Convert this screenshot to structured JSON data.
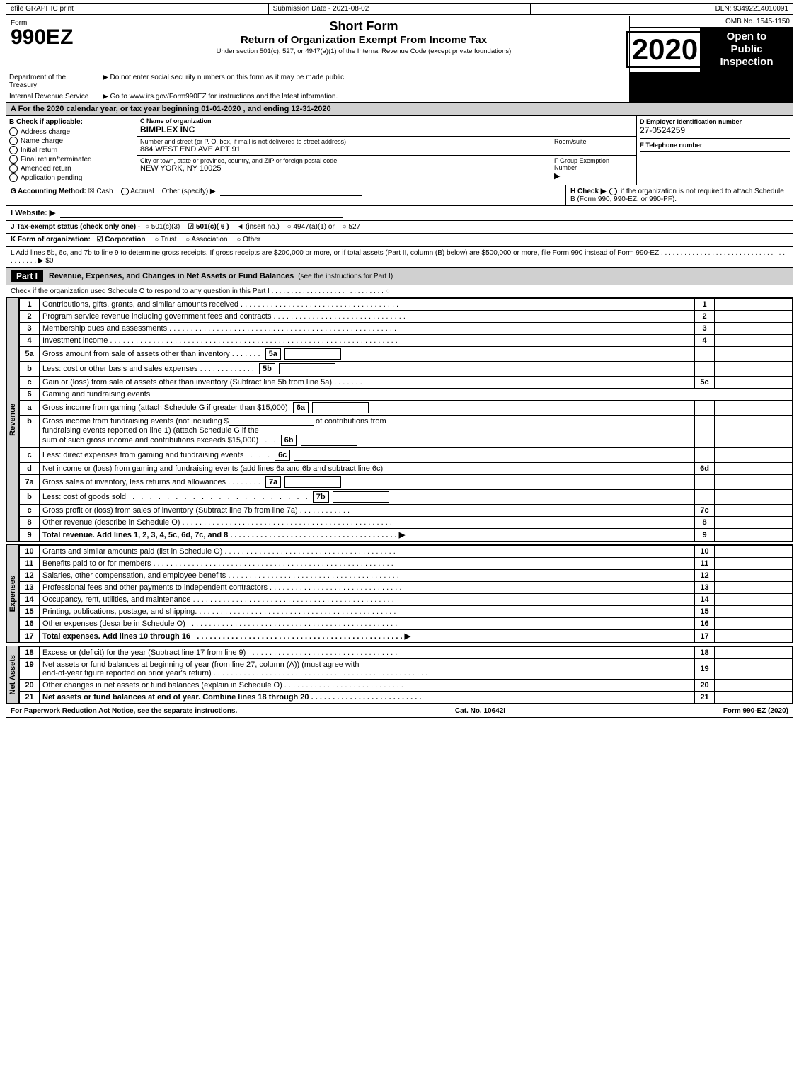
{
  "header": {
    "efile": "efile GRAPHIC print",
    "submission": "Submission Date - 2021-08-02",
    "dln": "DLN: 93492214010091",
    "form_label": "Form",
    "form_number": "990EZ",
    "short_form": "Short Form",
    "return_title": "Return of Organization Exempt From Income Tax",
    "subtitle": "Under section 501(c), 527, or 4947(a)(1) of the Internal Revenue Code (except private foundations)",
    "note1": "▶ Do not enter social security numbers on this form as it may be made public.",
    "note2": "▶ Go to www.irs.gov/Form990EZ for instructions and the latest information.",
    "year": "2020",
    "omb": "OMB No. 1545-1150",
    "open_line1": "Open to",
    "open_line2": "Public",
    "open_line3": "Inspection"
  },
  "dept": {
    "name": "Department of the Treasury",
    "irs": "Internal Revenue Service"
  },
  "year_line": "A  For the 2020 calendar year, or tax year beginning 01-01-2020 , and ending 12-31-2020",
  "section_b": {
    "label": "B  Check if applicable:",
    "items": [
      {
        "label": "Address change",
        "checked": false
      },
      {
        "label": "Name change",
        "checked": false
      },
      {
        "label": "Initial return",
        "checked": false
      },
      {
        "label": "Final return/terminated",
        "checked": false
      },
      {
        "label": "Amended return",
        "checked": false
      },
      {
        "label": "Application pending",
        "checked": false
      }
    ]
  },
  "section_c": {
    "label": "C Name of organization",
    "org_name": "BIMPLEX INC",
    "street_label": "Number and street (or P. O. box, if mail is not delivered to street address)",
    "street": "884 WEST END AVE APT 91",
    "room_label": "Room/suite",
    "room": "",
    "city_label": "City or town, state or province, country, and ZIP or foreign postal code",
    "city": "NEW YORK, NY  10025"
  },
  "section_d": {
    "label": "D Employer identification number",
    "ein": "27-0524259"
  },
  "section_e": {
    "label": "E Telephone number",
    "value": ""
  },
  "section_f": {
    "label": "F Group Exemption Number",
    "arrow": "▶",
    "value": ""
  },
  "section_g": {
    "label": "G Accounting Method:",
    "cash_checked": true,
    "cash_label": "Cash",
    "accrual_label": "Accrual",
    "other_label": "Other (specify) ▶"
  },
  "section_h": {
    "label": "H  Check ▶",
    "circle": "○",
    "text": "if the organization is not required to attach Schedule B (Form 990, 990-EZ, or 990-PF)."
  },
  "website": {
    "label": "I Website: ▶"
  },
  "tax_status": {
    "label": "J Tax-exempt status (check only one) -",
    "options": [
      {
        "label": "501(c)(3)",
        "checked": false
      },
      {
        "label": "501(c)( 6 )",
        "checked": true
      },
      {
        "label": "(insert no.)",
        "checked": false
      },
      {
        "label": "4947(a)(1) or",
        "checked": false
      },
      {
        "label": "527",
        "checked": false
      }
    ]
  },
  "form_org": {
    "label": "K Form of organization:",
    "corporation_checked": true,
    "corporation_label": "Corporation",
    "trust_label": "Trust",
    "association_label": "Association",
    "other_label": "Other"
  },
  "line_l": {
    "text": "L Add lines 5b, 6c, and 7b to line 9 to determine gross receipts. If gross receipts are $200,000 or more, or if total assets (Part II, column (B) below) are $500,000 or more, file Form 990 instead of Form 990-EZ . . . . . . . . . . . . . . . . . . . . . . . . . . . . . . . . . . . . . . . ▶ $0"
  },
  "part1": {
    "header": "Part I",
    "title": "Revenue, Expenses, and Changes in Net Assets or Fund Balances",
    "see_instructions": "(see the instructions for Part I)",
    "schedule_o_check": "Check if the organization used Schedule O to respond to any question in this Part I . . . . . . . . . . . . . . . . . . . . . . . . . . . . . ○",
    "rows": [
      {
        "num": "1",
        "desc": "Contributions, gifts, grants, and similar amounts received . . . . . . . . . . . . . . . . . . . . . . . . . . . . . . . . . . . . .",
        "line": "1",
        "value": ""
      },
      {
        "num": "2",
        "desc": "Program service revenue including government fees and contracts . . . . . . . . . . . . . . . . . . . . . . . . . . . . . . .",
        "line": "2",
        "value": ""
      },
      {
        "num": "3",
        "desc": "Membership dues and assessments . . . . . . . . . . . . . . . . . . . . . . . . . . . . . . . . . . . . . . . . . . . . . . . . . . . . .",
        "line": "3",
        "value": ""
      },
      {
        "num": "4",
        "desc": "Investment income . . . . . . . . . . . . . . . . . . . . . . . . . . . . . . . . . . . . . . . . . . . . . . . . . . . . . . . . . . . . . . . . . . .",
        "line": "4",
        "value": ""
      }
    ],
    "row5a": {
      "num": "5a",
      "desc": "Gross amount from sale of assets other than inventory . . . . . . .",
      "sub": "5a",
      "value": ""
    },
    "row5b": {
      "num": "b",
      "desc": "Less: cost or other basis and sales expenses . . . . . . . . . . . . .",
      "sub": "5b",
      "value": ""
    },
    "row5c": {
      "num": "c",
      "desc": "Gain or (loss) from sale of assets other than inventory (Subtract line 5b from line 5a) . . . . . . .",
      "line": "5c",
      "value": ""
    },
    "row6": {
      "num": "6",
      "desc": "Gaming and fundraising events",
      "value": ""
    },
    "row6a": {
      "num": "a",
      "desc": "Gross income from gaming (attach Schedule G if greater than $15,000)",
      "sub": "6a",
      "value": ""
    },
    "row6b": {
      "num": "b",
      "desc": "Gross income from fundraising events (not including $                              of contributions from fundraising events reported on line 1) (attach Schedule G if the sum of such gross income and contributions exceeds $15,000)   .   .",
      "sub": "6b",
      "value": ""
    },
    "row6c": {
      "num": "c",
      "desc": "Less: direct expenses from gaming and fundraising events   .   .   .",
      "sub": "6c",
      "value": ""
    },
    "row6d": {
      "num": "d",
      "desc": "Net income or (loss) from gaming and fundraising events (add lines 6a and 6b and subtract line 6c)",
      "line": "6d",
      "value": ""
    },
    "row7a": {
      "num": "7a",
      "desc": "Gross sales of inventory, less returns and allowances . . . . . . . .",
      "sub": "7a",
      "value": ""
    },
    "row7b": {
      "num": "b",
      "desc": "Less: cost of goods sold   .   .   .   .   .   .   .   .   .   .   .   .   .   .   .   .   .   .   .   .   .   .   .   .   .   .",
      "sub": "7b",
      "value": ""
    },
    "row7c": {
      "num": "c",
      "desc": "Gross profit or (loss) from sales of inventory (Subtract line 7b from line 7a) . . . . . . . . . . . .",
      "line": "7c",
      "value": ""
    },
    "row8": {
      "num": "8",
      "desc": "Other revenue (describe in Schedule O) . . . . . . . . . . . . . . . . . . . . . . . . . . . . . . . . . . . . . . . . . . . . . . . . .",
      "line": "8",
      "value": ""
    },
    "row9": {
      "num": "9",
      "desc": "Total revenue. Add lines 1, 2, 3, 4, 5c, 6d, 7c, and 8  . . . . . . . . . . . . . . . . . . . . . . . . . . . . . . . . . . . . . . . ▶",
      "line": "9",
      "value": "",
      "bold": true
    }
  },
  "expenses": {
    "label": "Expenses",
    "rows": [
      {
        "num": "10",
        "desc": "Grants and similar amounts paid (list in Schedule O) . . . . . . . . . . . . . . . . . . . . . . . . . . . . . . . . . . . . . . . .",
        "line": "10",
        "value": ""
      },
      {
        "num": "11",
        "desc": "Benefits paid to or for members . . . . . . . . . . . . . . . . . . . . . . . . . . . . . . . . . . . . . . . . . . . . . . . . . . . . . . . .",
        "line": "11",
        "value": ""
      },
      {
        "num": "12",
        "desc": "Salaries, other compensation, and employee benefits . . . . . . . . . . . . . . . . . . . . . . . . . . . . . . . . . . . . . . . .",
        "line": "12",
        "value": ""
      },
      {
        "num": "13",
        "desc": "Professional fees and other payments to independent contractors . . . . . . . . . . . . . . . . . . . . . . . . . . . . . . .",
        "line": "13",
        "value": ""
      },
      {
        "num": "14",
        "desc": "Occupancy, rent, utilities, and maintenance . . . . . . . . . . . . . . . . . . . . . . . . . . . . . . . . . . . . . . . . . . . . . . .",
        "line": "14",
        "value": ""
      },
      {
        "num": "15",
        "desc": "Printing, publications, postage, and shipping. . . . . . . . . . . . . . . . . . . . . . . . . . . . . . . . . . . . . . . . . . . . . . .",
        "line": "15",
        "value": ""
      },
      {
        "num": "16",
        "desc": "Other expenses (describe in Schedule O)  . . . . . . . . . . . . . . . . . . . . . . . . . . . . . . . . . . . . . . . . . . . . . . . .",
        "line": "16",
        "value": ""
      },
      {
        "num": "17",
        "desc": "Total expenses. Add lines 10 through 16  . . . . . . . . . . . . . . . . . . . . . . . . . . . . . . . . . . . . . . . . . . . . . . . . ▶",
        "line": "17",
        "value": "",
        "bold": true
      }
    ]
  },
  "net_assets": {
    "label": "Net Assets",
    "rows": [
      {
        "num": "18",
        "desc": "Excess or (deficit) for the year (Subtract line 17 from line 9)  . . . . . . . . . . . . . . . . . . . . . . . . . . . . . . . . . .",
        "line": "18",
        "value": ""
      },
      {
        "num": "19",
        "desc": "Net assets or fund balances at beginning of year (from line 27, column (A)) (must agree with end-of-year figure reported on prior year's return) . . . . . . . . . . . . . . . . . . . . . . . . . . . . . . . . . . . . . . . . . . . . . . . . . .",
        "line": "19",
        "value": ""
      },
      {
        "num": "20",
        "desc": "Other changes in net assets or fund balances (explain in Schedule O) . . . . . . . . . . . . . . . . . . . . . . . . . . . .",
        "line": "20",
        "value": ""
      },
      {
        "num": "21",
        "desc": "Net assets or fund balances at end of year. Combine lines 18 through 20 . . . . . . . . . . . . . . . . . . . . . . . . . .",
        "line": "21",
        "value": "",
        "bold": true
      }
    ]
  },
  "footer": {
    "left": "For Paperwork Reduction Act Notice, see the separate instructions.",
    "cat": "Cat. No. 10642I",
    "right": "Form 990-EZ (2020)"
  },
  "revenue_label": "Revenue"
}
